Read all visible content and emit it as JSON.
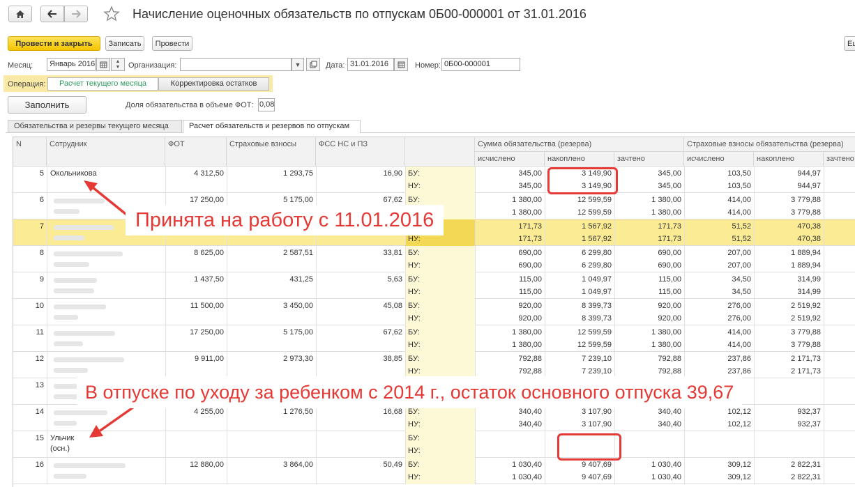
{
  "window": {
    "title": "Начисление оценочных обязательств по отпускам 0Б00-000001 от 31.01.2016"
  },
  "nav": {
    "home_icon": "home-icon",
    "back_icon": "arrow-left-icon",
    "forward_icon": "arrow-right-icon",
    "favorite_icon": "star-icon"
  },
  "toolbar": {
    "post_close_label": "Провести и закрыть",
    "save_label": "Записать",
    "post_label": "Провести",
    "more_label": "Ещ"
  },
  "form": {
    "month_label": "Месяц:",
    "month_value": "Январь 2016",
    "org_label": "Организация:",
    "org_value": "",
    "date_label": "Дата:",
    "date_value": "31.01.2016",
    "number_label": "Номер:",
    "number_value": "0Б00-000001",
    "operation_label": "Операция:",
    "operation_options": [
      "Расчет текущего месяца",
      "Корректировка остатков"
    ],
    "operation_selected": "Расчет текущего месяца",
    "fill_button": "Заполнить",
    "fot_share_label": "Доля обязательства в объеме ФОТ:",
    "fot_share_value": "0,08"
  },
  "tabs": [
    "Обязательства и резервы текущего месяца",
    "Расчет обязательств и резервов по отпускам"
  ],
  "grid": {
    "headers": {
      "n": "N",
      "employee": "Сотрудник",
      "fot": "ФОТ",
      "insurance": "Страховые взносы",
      "fss": "ФСС НС и ПЗ",
      "liability_group": "Сумма обязательства (резерва)",
      "ins_liability_group": "Страховые взносы обязательства (резерва)",
      "calc": "исчислено",
      "accum": "накоплено",
      "offset": "зачтено"
    },
    "rows": [
      {
        "n": "5",
        "name": "Окольникова",
        "name2": "",
        "fot": "4 312,50",
        "ins": "1 293,75",
        "fss": "16,90",
        "bu": [
          "345,00",
          "3 149,90",
          "345,00",
          "103,50",
          "944,97"
        ],
        "nu": [
          "345,00",
          "3 149,90",
          "345,00",
          "103,50",
          "944,97"
        ],
        "hl": false
      },
      {
        "n": "6",
        "name": "",
        "name2": "",
        "fot": "17 250,00",
        "ins": "5 175,00",
        "fss": "67,62",
        "bu": [
          "1 380,00",
          "12 599,59",
          "1 380,00",
          "414,00",
          "3 779,88"
        ],
        "nu": [
          "1 380,00",
          "12 599,59",
          "1 380,00",
          "414,00",
          "3 779,88"
        ],
        "hl": false
      },
      {
        "n": "7",
        "name": "",
        "name2": "",
        "fot": "",
        "ins": "",
        "fss": "",
        "bu": [
          "171,73",
          "1 567,92",
          "171,73",
          "51,52",
          "470,38"
        ],
        "nu": [
          "171,73",
          "1 567,92",
          "171,73",
          "51,52",
          "470,38"
        ],
        "hl": true
      },
      {
        "n": "8",
        "name": "",
        "name2": "",
        "fot": "8 625,00",
        "ins": "2 587,51",
        "fss": "33,81",
        "bu": [
          "690,00",
          "6 299,80",
          "690,00",
          "207,00",
          "1 889,94"
        ],
        "nu": [
          "690,00",
          "6 299,80",
          "690,00",
          "207,00",
          "1 889,94"
        ],
        "hl": false
      },
      {
        "n": "9",
        "name": "",
        "name2": "",
        "fot": "1 437,50",
        "ins": "431,25",
        "fss": "5,63",
        "bu": [
          "115,00",
          "1 049,97",
          "115,00",
          "34,50",
          "314,99"
        ],
        "nu": [
          "115,00",
          "1 049,97",
          "115,00",
          "34,50",
          "314,99"
        ],
        "hl": false
      },
      {
        "n": "10",
        "name": "",
        "name2": "",
        "fot": "11 500,00",
        "ins": "3 450,00",
        "fss": "45,08",
        "bu": [
          "920,00",
          "8 399,73",
          "920,00",
          "276,00",
          "2 519,92"
        ],
        "nu": [
          "920,00",
          "8 399,73",
          "920,00",
          "276,00",
          "2 519,92"
        ],
        "hl": false
      },
      {
        "n": "11",
        "name": "",
        "name2": "",
        "fot": "17 250,00",
        "ins": "5 175,00",
        "fss": "67,62",
        "bu": [
          "1 380,00",
          "12 599,59",
          "1 380,00",
          "414,00",
          "3 779,88"
        ],
        "nu": [
          "1 380,00",
          "12 599,59",
          "1 380,00",
          "414,00",
          "3 779,88"
        ],
        "hl": false
      },
      {
        "n": "12",
        "name": "",
        "name2": "",
        "fot": "9 911,00",
        "ins": "2 973,30",
        "fss": "38,85",
        "bu": [
          "792,88",
          "7 239,10",
          "792,88",
          "237,86",
          "2 171,73"
        ],
        "nu": [
          "792,88",
          "7 239,10",
          "792,88",
          "237,86",
          "2 171,73"
        ],
        "hl": false
      },
      {
        "n": "13",
        "name": "",
        "name2": "",
        "fot": "",
        "ins": "",
        "fss": "",
        "bu": [
          "",
          "",
          "",
          "",
          ""
        ],
        "nu": [
          "",
          "",
          "",
          "",
          ""
        ],
        "hl": false
      },
      {
        "n": "14",
        "name": "",
        "name2": "",
        "fot": "4 255,00",
        "ins": "1 276,50",
        "fss": "16,68",
        "bu": [
          "340,40",
          "3 107,90",
          "340,40",
          "102,12",
          "932,37"
        ],
        "nu": [
          "340,40",
          "3 107,90",
          "340,40",
          "102,12",
          "932,37"
        ],
        "hl": false
      },
      {
        "n": "15",
        "name": "Ульчик",
        "name2": "(осн.)",
        "fot": "",
        "ins": "",
        "fss": "",
        "bu": [
          "",
          "",
          "",
          "",
          ""
        ],
        "nu": [
          "",
          "",
          "",
          "",
          ""
        ],
        "hl": false
      },
      {
        "n": "16",
        "name": "",
        "name2": "",
        "fot": "12 880,00",
        "ins": "3 864,00",
        "fss": "50,49",
        "bu": [
          "1 030,40",
          "9 407,69",
          "1 030,40",
          "309,12",
          "2 822,31"
        ],
        "nu": [
          "1 030,40",
          "9 407,69",
          "1 030,40",
          "309,12",
          "2 822,31"
        ],
        "hl": false
      }
    ],
    "bu_label": "БУ:",
    "nu_label": "НУ:"
  },
  "annotations": {
    "hired": "Принята на работу с 11.01.2016",
    "maternity": "В отпуске по уходу за ребенком с 2014 г., остаток основного отпуска  39,67"
  },
  "colors": {
    "primary_button": "#f4c400",
    "annotation": "#e53935",
    "highlight_row": "#fbeb95"
  }
}
